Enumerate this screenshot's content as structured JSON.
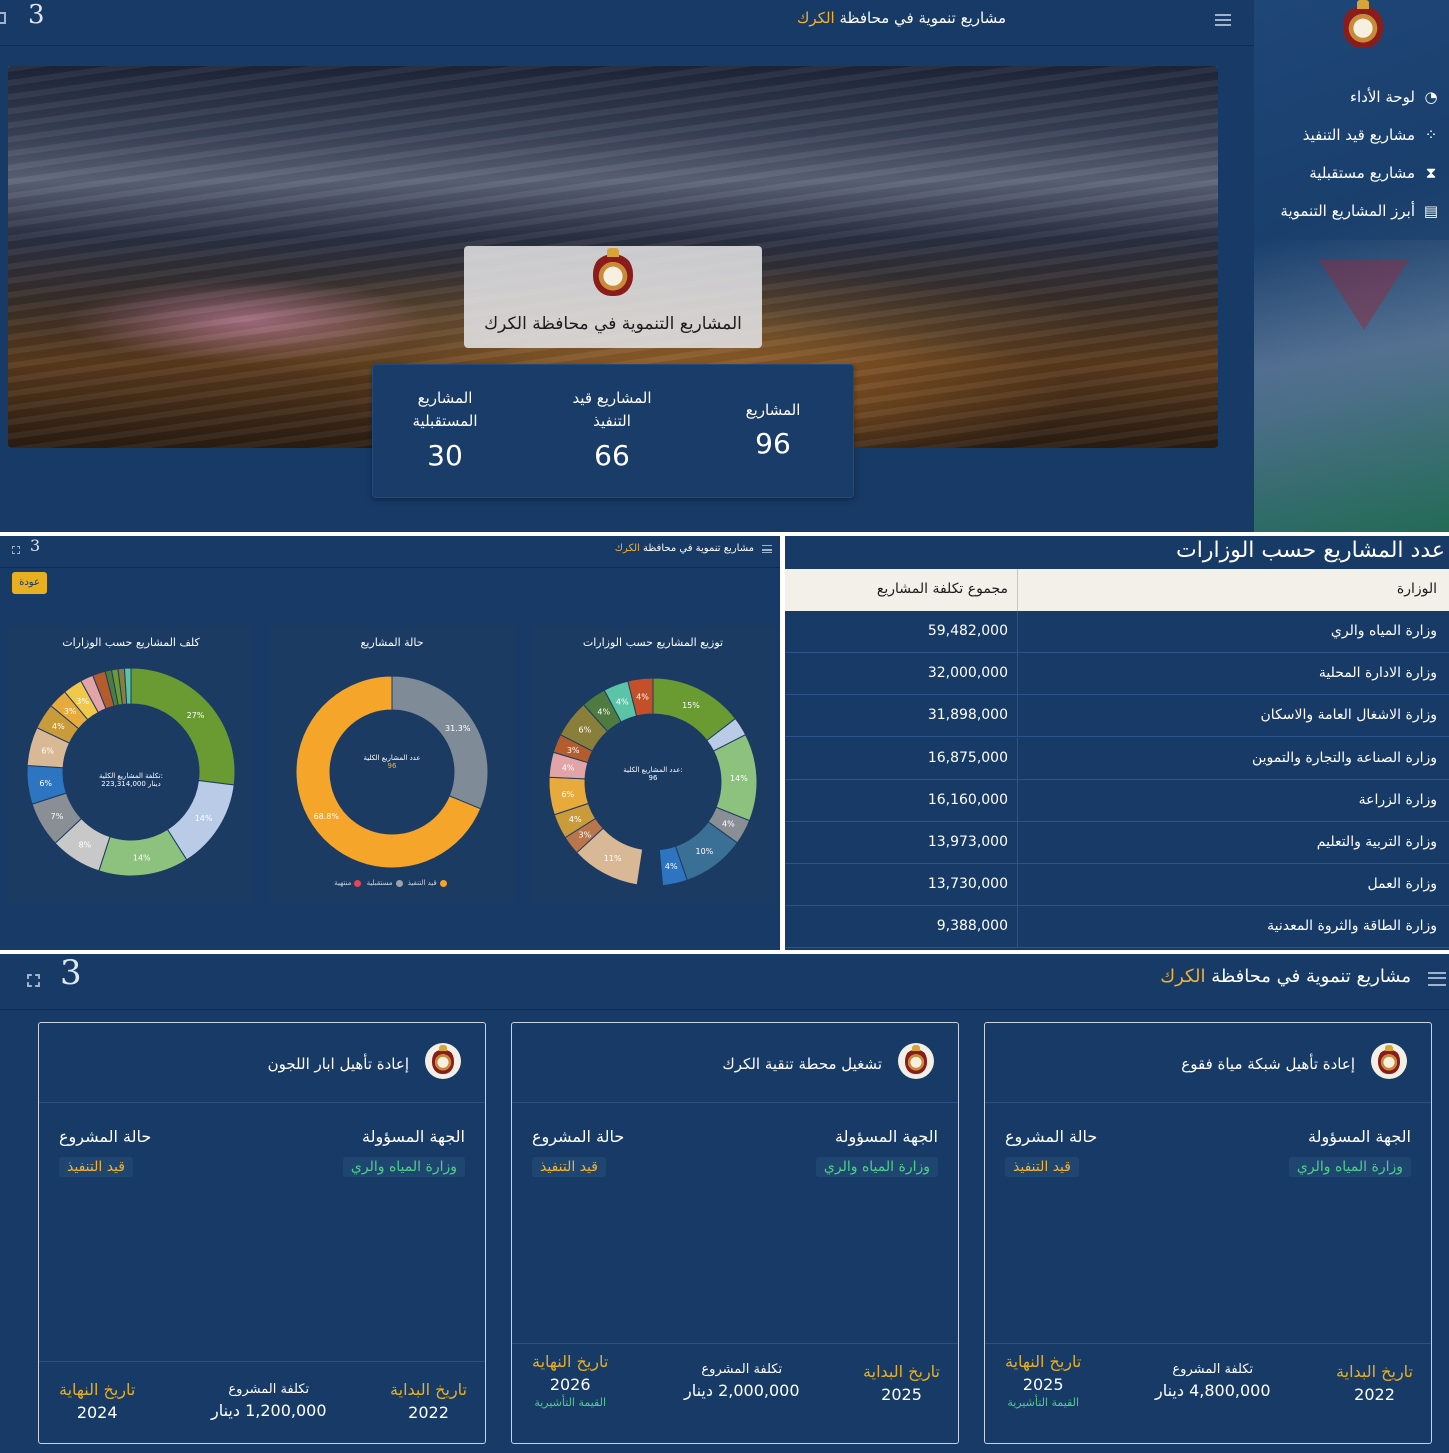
{
  "top": {
    "page_title_prefix": "مشاريع تنموية في محافظة",
    "page_title_city": "الكرك",
    "sidebar": {
      "items": [
        {
          "label": "لوحة الأداء",
          "icon": "dashboard-gauge-icon"
        },
        {
          "label": "مشاريع قيد التنفيذ",
          "icon": "spinner-icon"
        },
        {
          "label": "مشاريع مستقبلية",
          "icon": "hourglass-icon"
        },
        {
          "label": "أبرز المشاريع التنموية",
          "icon": "pdf-file-icon"
        }
      ]
    },
    "hero_title": "المشاريع التنموية في محافظة الكرك",
    "stats": [
      {
        "label": "المشاريع",
        "value": "96"
      },
      {
        "label": "المشاريع قيد التنفيذ",
        "value": "66"
      },
      {
        "label": "المشاريع المستقبلية",
        "value": "30"
      }
    ]
  },
  "charts_panel": {
    "title_prefix": "مشاريع تنموية في محافظة",
    "title_city": "الكرك",
    "back_label": "عودة",
    "cards": {
      "distribution_title": "توزيع المشاريع حسب الوزارات",
      "status_title": "حالة المشاريع",
      "cost_title": "كلف المشاريع حسب الوزارات"
    },
    "distribution_center": [
      "عدد المشاريع الكلية:",
      "96"
    ],
    "status_center": [
      "عدد المشاريع الكلية",
      "96"
    ],
    "cost_center": [
      "تكلفة المشاريع الكلية:",
      "223,314,000 دينار"
    ],
    "status_legend": [
      "قيد التنفيذ",
      "مستقبلية",
      "منتهية"
    ]
  },
  "chart_data": [
    {
      "type": "pie",
      "title": "توزيع المشاريع حسب الوزارات",
      "values": [
        15,
        3,
        14,
        4,
        10,
        4,
        4,
        11,
        3,
        4,
        6,
        4,
        3,
        6,
        4,
        4,
        4
      ],
      "labels": [
        "15%",
        "",
        "14%",
        "4%",
        "10%",
        "4%",
        "",
        "11%",
        "3%",
        "4%",
        "6%",
        "4%",
        "3%",
        "6%",
        "4%",
        "4%",
        "4%"
      ],
      "colors": [
        "#6a9a32",
        "#b9cbe6",
        "#8cc27e",
        "#8a8f96",
        "#3a6f96",
        "#2d75c0",
        "#1c3b63",
        "#d9b995",
        "#b8764a",
        "#c99b3a",
        "#e9aa3c",
        "#e2a4a6",
        "#b45c2c",
        "#8a7f3a",
        "#4f7a40",
        "#5cc4a6",
        "#c4502a"
      ]
    },
    {
      "type": "pie",
      "title": "حالة المشاريع",
      "values": [
        31.3,
        68.8
      ],
      "labels": [
        "31.3%",
        "68.8%"
      ],
      "colors": [
        "#7f8c98",
        "#f4a52a"
      ]
    },
    {
      "type": "pie",
      "title": "كلف المشاريع حسب الوزارات",
      "values": [
        27,
        14,
        14,
        8,
        7,
        6,
        6,
        4,
        3,
        3,
        2,
        2,
        1,
        1,
        1,
        1
      ],
      "labels": [
        "27%",
        "14%",
        "14%",
        "8%",
        "7%",
        "6%",
        "6%",
        "4%",
        "3%",
        "3%",
        "",
        "",
        "",
        "",
        "",
        ""
      ],
      "colors": [
        "#6a9a32",
        "#b9cbe6",
        "#8cc27e",
        "#c8c8c8",
        "#8a8f96",
        "#2d75c0",
        "#d9b995",
        "#c99b3a",
        "#e9aa3c",
        "#f0c84a",
        "#e2a4a6",
        "#b45c2c",
        "#4f7a40",
        "#6a9a32",
        "#8a7f3a",
        "#5cc4a6"
      ]
    }
  ],
  "ministries_table": {
    "title": "عدد المشاريع حسب الوزارات",
    "col_ministry": "الوزارة",
    "col_cost": "مجموع تكلفة المشاريع",
    "rows": [
      {
        "name": "وزارة المياه والري",
        "cost": "59,482,000"
      },
      {
        "name": "وزارة الادارة المحلية",
        "cost": "32,000,000"
      },
      {
        "name": "وزارة الاشغال العامة والاسكان",
        "cost": "31,898,000"
      },
      {
        "name": "وزارة الصناعة والتجارة والتموين",
        "cost": "16,875,000"
      },
      {
        "name": "وزارة الزراعة",
        "cost": "16,160,000"
      },
      {
        "name": "وزارة التربية والتعليم",
        "cost": "13,973,000"
      },
      {
        "name": "وزارة العمل",
        "cost": "13,730,000"
      },
      {
        "name": "وزارة الطاقة والثروة المعدنية",
        "cost": "9,388,000"
      }
    ]
  },
  "projects_panel": {
    "title_prefix": "مشاريع تنموية في محافظة",
    "title_city": "الكرك",
    "labels": {
      "responsible": "الجهة المسؤولة",
      "status": "حالة المشروع",
      "start": "تاريخ البداية",
      "cost": "تكلفة المشروع",
      "end": "تاريخ النهاية"
    },
    "projects": [
      {
        "title": "إعادة تأهيل شبكة مياة فقوع",
        "responsible": "وزارة المياه والري",
        "status": "قيد التنفيذ",
        "start": "2022",
        "cost": "4,800,000 دينار",
        "end": "2025",
        "end_note": "القيمة التأشيرية"
      },
      {
        "title": "تشغيل محطة تنقية الكرك",
        "responsible": "وزارة المياه والري",
        "status": "قيد التنفيذ",
        "start": "2025",
        "cost": "2,000,000 دينار",
        "end": "2026",
        "end_note": "القيمة التأشيرية"
      },
      {
        "title": "إعادة تأهيل ابار اللجون",
        "responsible": "وزارة المياه والري",
        "status": "قيد التنفيذ",
        "start": "2022",
        "cost": "1,200,000 دينار",
        "end": "2024",
        "end_note": ""
      }
    ]
  }
}
